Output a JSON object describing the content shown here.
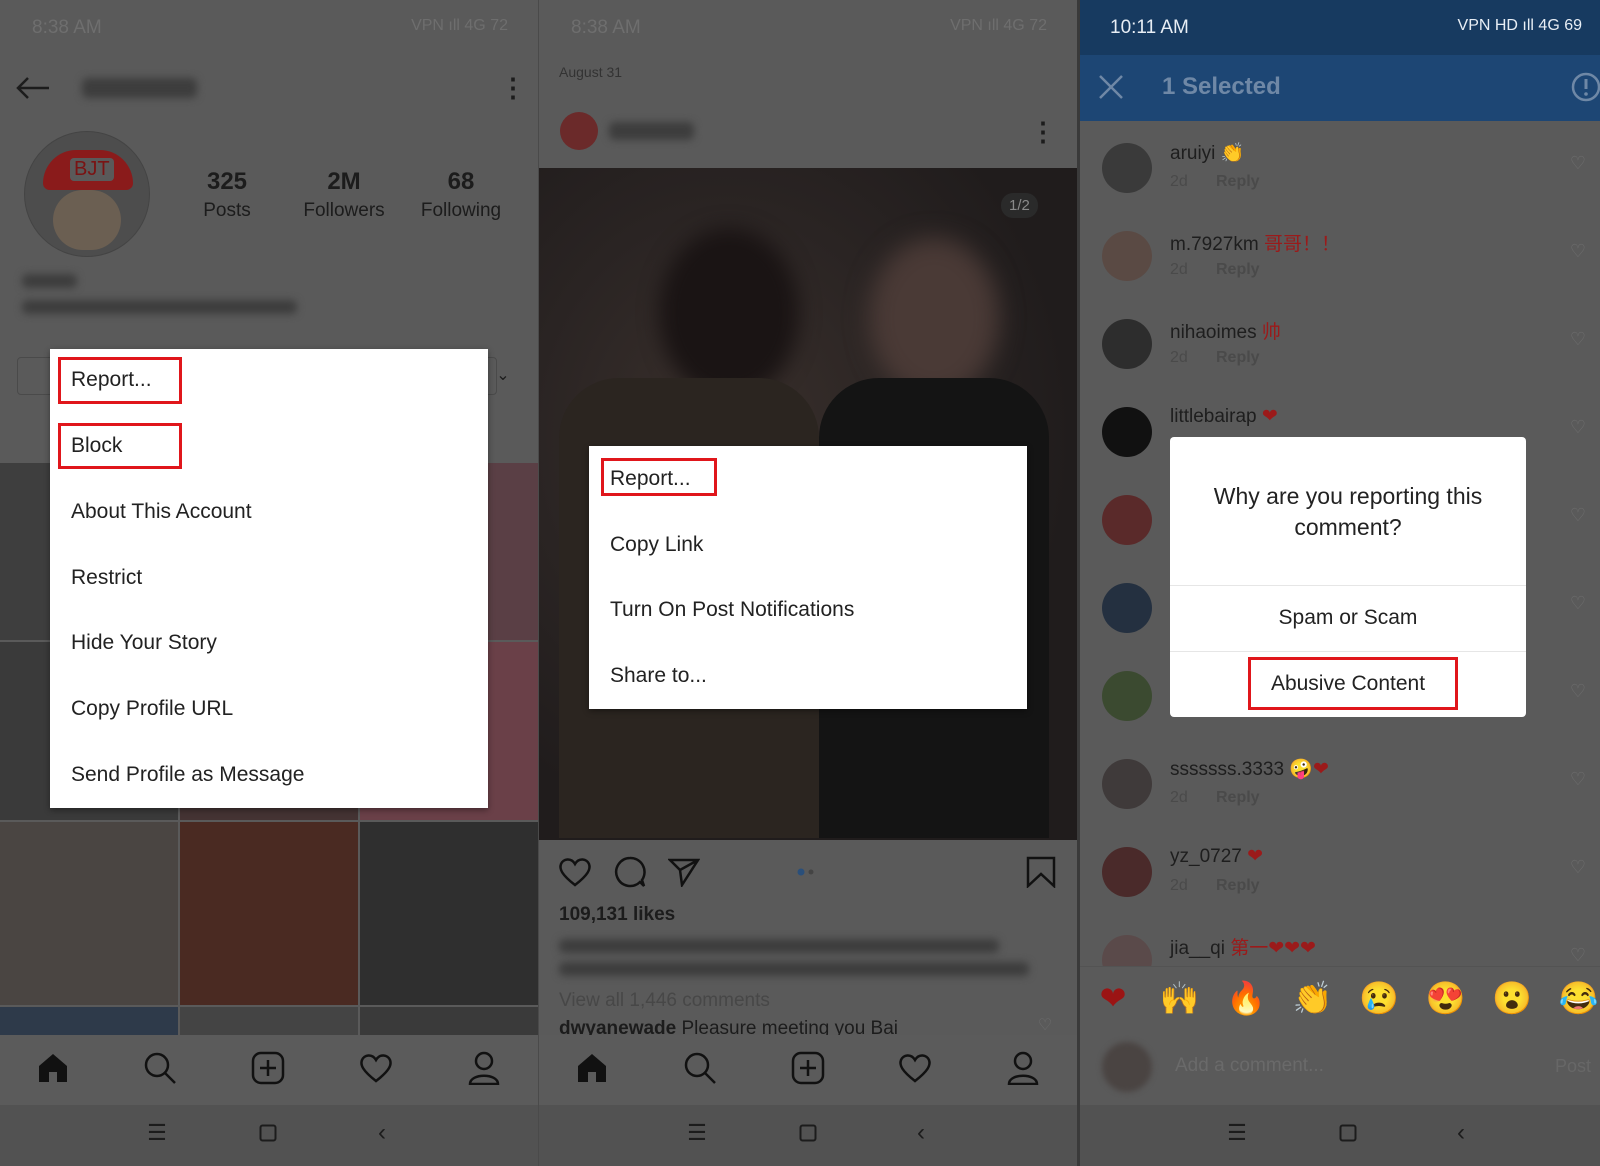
{
  "colors": {
    "highlight": "#e0161b",
    "header_blue": "#1d4674",
    "status_blue": "#173a60"
  },
  "profile": {
    "status_time": "8:38 AM",
    "status_right": "VPN ıll 4G 72",
    "stats": [
      {
        "value": "325",
        "label": "Posts"
      },
      {
        "value": "2M",
        "label": "Followers"
      },
      {
        "value": "68",
        "label": "Following"
      }
    ],
    "avatar_text": "BJT",
    "menu": [
      "Report...",
      "Block",
      "About This Account",
      "Restrict",
      "Hide Your Story",
      "Copy Profile URL",
      "Send Profile as Message"
    ],
    "highlighted": [
      "Report...",
      "Block"
    ]
  },
  "post": {
    "status_time": "8:38 AM",
    "status_right": "VPN ıll 4G 72",
    "date": "August 31",
    "page_indicator": "1/2",
    "menu": [
      "Report...",
      "Copy Link",
      "Turn On Post Notifications",
      "Share to..."
    ],
    "highlighted": [
      "Report..."
    ],
    "likes": "109,131 likes",
    "view_all": "View all 1,446 comments",
    "comment_user": "dwyanewade",
    "comment_text": "Pleasure meeting you Bai"
  },
  "comments": {
    "status_time": "10:11 AM",
    "status_right": "VPN HD ıll 4G 69",
    "title": "1 Selected",
    "items": [
      {
        "name": "aruiyi",
        "emoji": "👏",
        "time": "2d",
        "reply": "Reply"
      },
      {
        "name": "m.7927km",
        "emoji": "哥哥！！",
        "time": "2d",
        "reply": "Reply"
      },
      {
        "name": "nihaoimes",
        "emoji": "帅",
        "time": "2d",
        "reply": "Reply"
      },
      {
        "name": "littlebairap",
        "emoji": "❤",
        "time": "",
        "reply": ""
      },
      {
        "name": "",
        "emoji": "",
        "time": "",
        "reply": ""
      },
      {
        "name": "",
        "emoji": "",
        "time": "",
        "reply": ""
      },
      {
        "name": "",
        "emoji": "",
        "time": "",
        "reply": ""
      },
      {
        "name": "sssssss.3333",
        "emoji": "🤪❤",
        "time": "2d",
        "reply": "Reply"
      },
      {
        "name": "yz_0727",
        "emoji": "❤",
        "time": "2d",
        "reply": "Reply"
      },
      {
        "name": "jia__qi",
        "emoji": "第一❤❤❤",
        "time": "",
        "reply": ""
      }
    ],
    "dialog": {
      "question": "Why are you reporting this comment?",
      "options": [
        "Spam or Scam",
        "Abusive Content"
      ],
      "highlighted": "Abusive Content"
    },
    "emoji_bar": [
      "❤",
      "🙌",
      "🔥",
      "👏",
      "😢",
      "😍",
      "😮",
      "😂"
    ],
    "input_placeholder": "Add a comment...",
    "post_label": "Post"
  }
}
